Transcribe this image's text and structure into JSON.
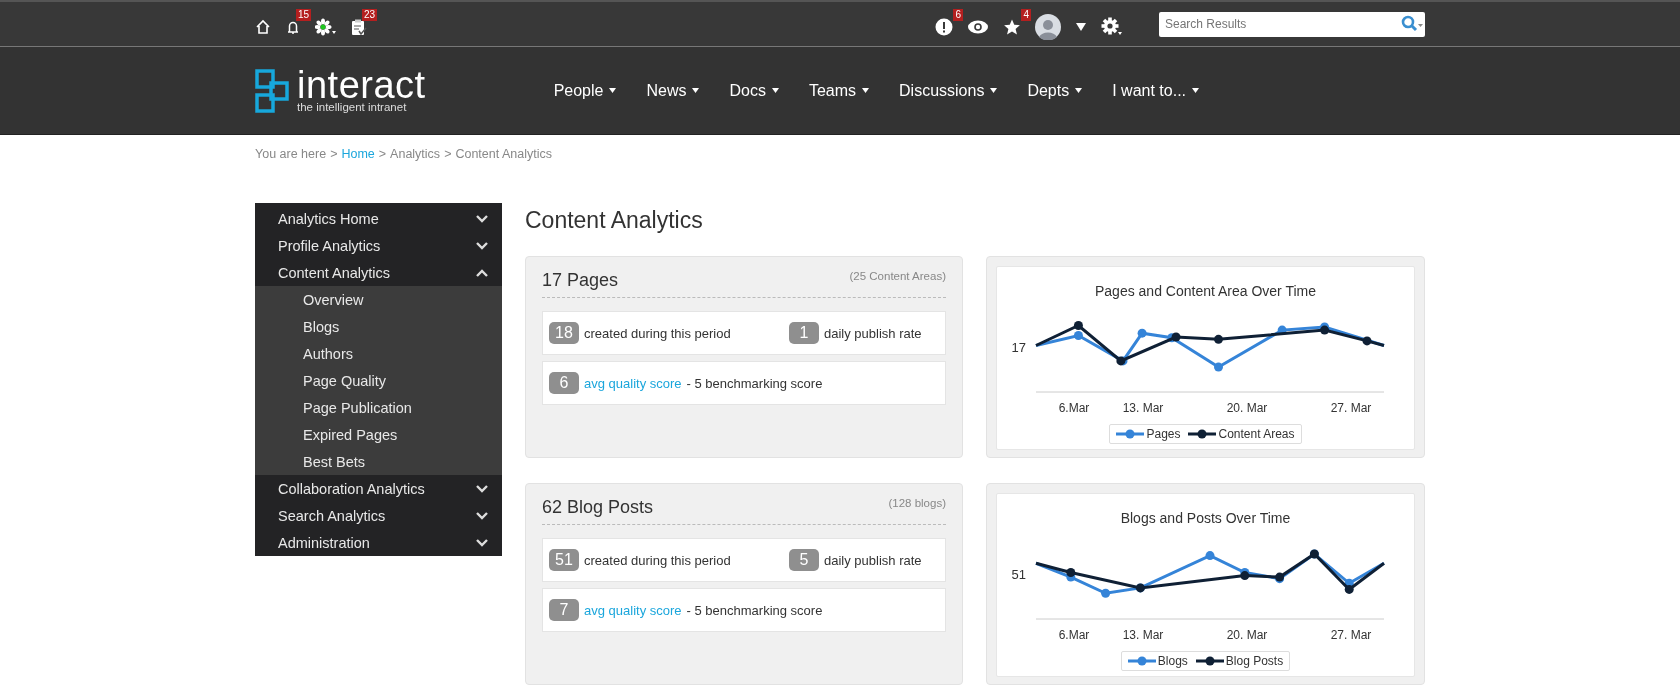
{
  "top_bar": {
    "left_icons": [
      {
        "kind": "home"
      },
      {
        "kind": "bell",
        "badge": "15"
      },
      {
        "kind": "flower"
      },
      {
        "kind": "clipboard",
        "badge": "23"
      }
    ],
    "right_icons": [
      {
        "kind": "alert",
        "badge": "6"
      },
      {
        "kind": "eye"
      },
      {
        "kind": "star",
        "badge": "4"
      },
      {
        "kind": "avatar"
      },
      {
        "kind": "caret"
      },
      {
        "kind": "gear"
      }
    ],
    "search": {
      "placeholder": "Search Results"
    }
  },
  "logo": {
    "name": "interact",
    "tagline": "the intelligent intranet"
  },
  "nav": [
    "People",
    "News",
    "Docs",
    "Teams",
    "Discussions",
    "Depts",
    "I want to..."
  ],
  "breadcrumb": {
    "separator": ">",
    "items": [
      {
        "label": "You are here",
        "link": false
      },
      {
        "label": "Home",
        "link": true
      },
      {
        "label": "Analytics",
        "link": false
      },
      {
        "label": "Content Analytics",
        "link": false
      }
    ]
  },
  "sidebar": {
    "items": [
      {
        "label": "Analytics Home",
        "expanded": false
      },
      {
        "label": "Profile Analytics",
        "expanded": false
      },
      {
        "label": "Content Analytics",
        "expanded": true,
        "children": [
          {
            "label": "Overview"
          },
          {
            "label": "Blogs"
          },
          {
            "label": "Authors"
          },
          {
            "label": "Page Quality"
          },
          {
            "label": "Page Publication"
          },
          {
            "label": "Expired Pages"
          },
          {
            "label": "Best Bets"
          }
        ]
      },
      {
        "label": "Collaboration Analytics",
        "expanded": false
      },
      {
        "label": "Search Analytics",
        "expanded": false
      },
      {
        "label": "Administration",
        "expanded": false
      }
    ]
  },
  "page_title": "Content Analytics",
  "sections": [
    {
      "title": "17 Pages",
      "subtitle": "(25 Content Areas)",
      "stats": [
        {
          "value": "18",
          "label": "created during this period"
        },
        {
          "value": "1",
          "label": "daily publish rate"
        }
      ],
      "quality": {
        "value": "6",
        "link": "avg quality score",
        "rest": "- 5 benchmarking score"
      },
      "chart": {
        "title": "Pages and Content Area Over Time",
        "y_label": "17",
        "x_labels": [
          "6.Mar",
          "13. Mar",
          "20. Mar",
          "27. Mar"
        ],
        "legend": [
          {
            "label": "Pages",
            "color": "#3584d8"
          },
          {
            "label": "Content Areas",
            "color": "#0f2035"
          }
        ]
      }
    },
    {
      "title": "62 Blog Posts",
      "subtitle": "(128 blogs)",
      "stats": [
        {
          "value": "51",
          "label": "created during this period"
        },
        {
          "value": "5",
          "label": "daily publish rate"
        }
      ],
      "quality": {
        "value": "7",
        "link": "avg quality score",
        "rest": "- 5 benchmarking score"
      },
      "chart": {
        "title": "Blogs and Posts Over Time",
        "y_label": "51",
        "x_labels": [
          "6.Mar",
          "13. Mar",
          "20. Mar",
          "27. Mar"
        ],
        "legend": [
          {
            "label": "Blogs",
            "color": "#3584d8"
          },
          {
            "label": "Blog Posts",
            "color": "#0f2035"
          }
        ]
      }
    }
  ]
}
